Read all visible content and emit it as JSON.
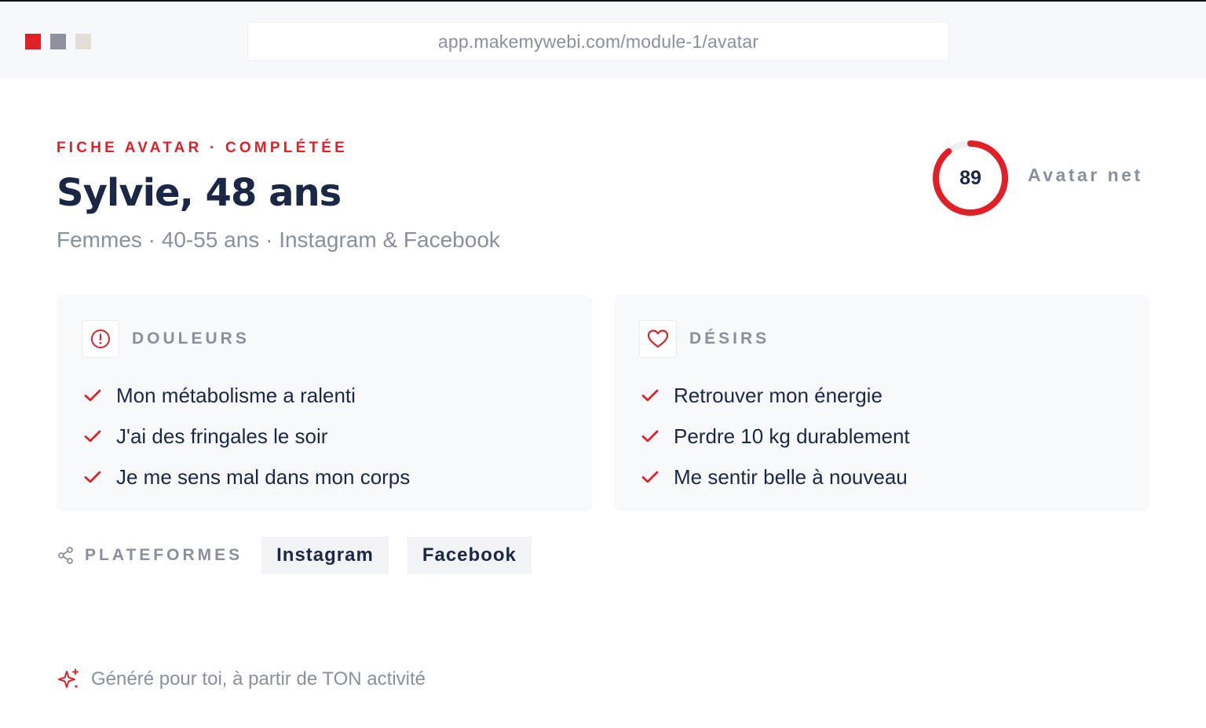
{
  "browser": {
    "url": "app.makemywebi.com/module-1/avatar",
    "dots": [
      "#e01f26",
      "#8e919d",
      "#e3ddd3"
    ]
  },
  "header": {
    "eyebrow": "FICHE AVATAR · COMPLÉTÉE",
    "title": "Sylvie, 48 ans",
    "subtitle": "Femmes · 40-55 ans · Instagram & Facebook"
  },
  "score": {
    "value": "89",
    "percent": 89,
    "label": "Avatar net",
    "color": "#e01f26",
    "track_color": "#eeeff2"
  },
  "pains": {
    "title": "DOULEURS",
    "icon": "alert-circle-icon",
    "items": [
      "Mon métabolisme a ralenti",
      "J'ai des fringales le soir",
      "Je me sens mal dans mon corps"
    ]
  },
  "desires": {
    "title": "DÉSIRS",
    "icon": "heart-icon",
    "items": [
      "Retrouver mon énergie",
      "Perdre 10 kg durablement",
      "Me sentir belle à nouveau"
    ]
  },
  "platforms": {
    "label": "PLATEFORMES",
    "icon": "share-icon",
    "items": [
      "Instagram",
      "Facebook"
    ]
  },
  "footer": {
    "icon": "sparkles-icon",
    "text": "Généré pour toi, à partir de TON activité"
  },
  "colors": {
    "accent": "#d9232a",
    "text": "#1b2845",
    "muted": "#8a8f9c"
  }
}
